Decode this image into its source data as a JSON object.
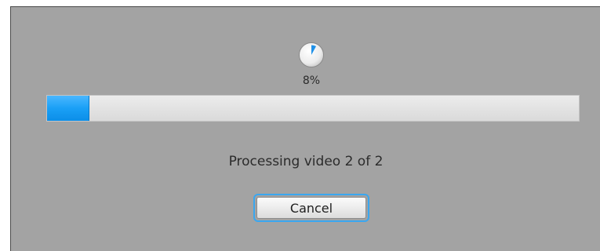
{
  "progress": {
    "percent_label": "8%",
    "fraction": 0.08,
    "status_text": "Processing video 2 of 2"
  },
  "buttons": {
    "cancel_label": "Cancel"
  },
  "icons": {
    "pie": "progress-pie-icon"
  },
  "colors": {
    "dialog_background": "#a3a3a3",
    "progress_fill": "#1aa0f6",
    "progress_track": "#e2e2e2",
    "pie_fill": "#1e90e8",
    "focus_ring": "#3aa7f0"
  }
}
